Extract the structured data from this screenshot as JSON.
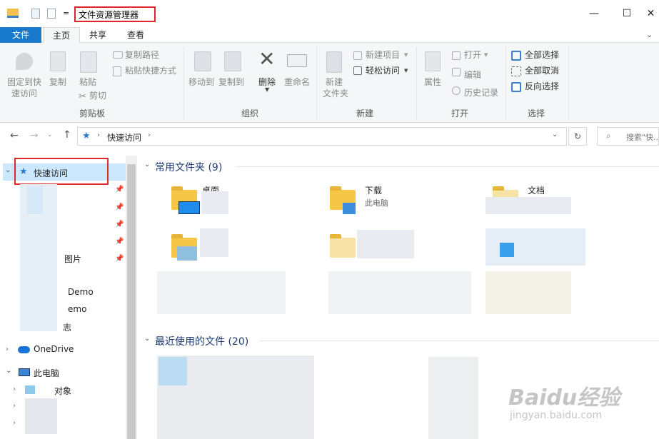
{
  "window": {
    "title": "文件资源管理器",
    "qat_dropdown": "=",
    "min": "—",
    "max": "☐",
    "close": "✕"
  },
  "tabs": [
    "文件",
    "主页",
    "共享",
    "查看"
  ],
  "ribbon": {
    "clipboard": {
      "pin": "固定到快\n速访问",
      "pin_l1": "固定到快",
      "pin_l2": "速访问",
      "copy": "复制",
      "paste": "粘贴",
      "copy_path": "复制路径",
      "paste_shortcut": "粘贴快捷方式",
      "cut": "剪切",
      "group": "剪贴板"
    },
    "organize": {
      "move_to": "移动到",
      "copy_to": "复制到",
      "delete": "删除",
      "rename": "重命名",
      "group": "组织"
    },
    "new": {
      "new_folder_l1": "新建",
      "new_folder_l2": "文件夹",
      "new_item": "新建项目",
      "easy_access": "轻松访问",
      "group": "新建"
    },
    "open": {
      "properties": "属性",
      "open": "打开",
      "edit": "编辑",
      "history": "历史记录",
      "group": "打开"
    },
    "select": {
      "select_all": "全部选择",
      "select_none": "全部取消",
      "invert": "反向选择",
      "group": "选择"
    }
  },
  "address": {
    "path": "快速访问",
    "search_placeholder": "搜索\"快..."
  },
  "nav": {
    "quick_access": "快速访问",
    "items": [
      "图片",
      "Demo",
      "emo",
      "志"
    ],
    "onedrive": "OneDrive",
    "this_pc": "此电脑",
    "pc_items": [
      "对象"
    ]
  },
  "content": {
    "frequent_header": "常用文件夹 (9)",
    "recent_header": "最近使用的文件 (20)",
    "folders": [
      {
        "name": "桌面",
        "sub": ""
      },
      {
        "name": "下载",
        "sub": "此电脑"
      },
      {
        "name": "文档",
        "sub": ""
      }
    ]
  },
  "watermark": {
    "brand": "Baidu经验",
    "url": "jingyan.baidu.com"
  },
  "colors": {
    "accent": "#1979ca",
    "highlight": "#cce8ff",
    "annotation": "#e0262a"
  }
}
